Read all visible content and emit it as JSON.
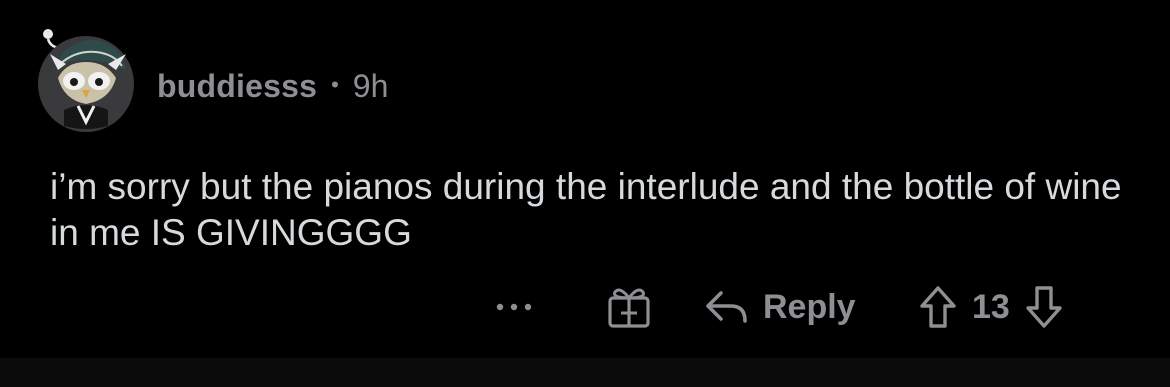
{
  "comment": {
    "username": "buddiesss",
    "separator": "•",
    "age": "9h",
    "body": "i’m sorry but the pianos during the interlude and the bottle of wine in me IS GIVINGGGG"
  },
  "actions": {
    "more_icon": "more-horizontal-icon",
    "award_icon": "gift-award-icon",
    "reply_icon": "reply-arrow-icon",
    "reply_label": "Reply",
    "upvote_icon": "upvote-arrow-icon",
    "vote_count": "13",
    "downvote_icon": "downvote-arrow-icon"
  },
  "colors": {
    "background": "#000000",
    "body_text": "#d7dadc",
    "muted_text": "#8e8f93"
  }
}
